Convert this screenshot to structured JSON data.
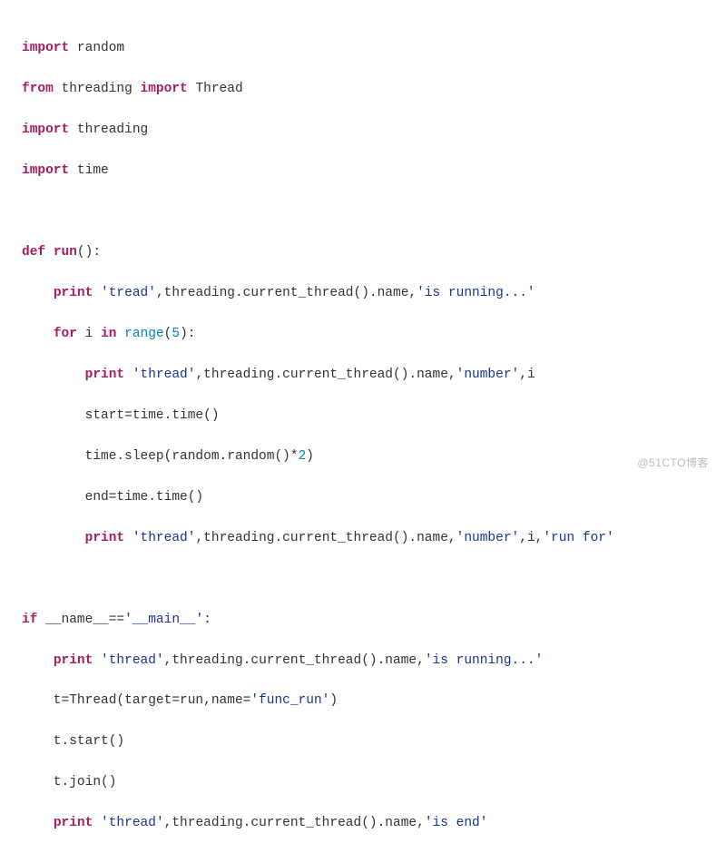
{
  "code": {
    "l1": {
      "a": "import",
      "b": " random"
    },
    "l2": {
      "a": "from",
      "b": " threading ",
      "c": "import",
      "d": " Thread"
    },
    "l3": {
      "a": "import",
      "b": " threading"
    },
    "l4": {
      "a": "import",
      "b": " time"
    },
    "l6": {
      "a": "def ",
      "b": "run",
      "c": "():"
    },
    "l7": {
      "a": "    ",
      "b": "print ",
      "c": "'tread'",
      "d": ",threading.current_thread().name,",
      "e": "'is running...'"
    },
    "l8": {
      "a": "    ",
      "b": "for",
      "c": " i ",
      "d": "in ",
      "e": "range",
      "f": "(",
      "g": "5",
      "h": "):"
    },
    "l9": {
      "a": "        ",
      "b": "print ",
      "c": "'thread'",
      "d": ",threading.current_thread().name,",
      "e": "'number'",
      "f": ",i"
    },
    "l10": {
      "a": "        start=time.time()"
    },
    "l11": {
      "a": "        time.sleep(random.random()*",
      "b": "2",
      "c": ")"
    },
    "l12": {
      "a": "        end=time.time()"
    },
    "l13": {
      "a": "        ",
      "b": "print ",
      "c": "'thread'",
      "d": ",threading.current_thread().name,",
      "e": "'number'",
      "f": ",i,",
      "g": "'run for'"
    },
    "l15": {
      "a": "if",
      "b": " __name__==",
      "c": "'__main__'",
      "d": ":"
    },
    "l16": {
      "a": "    ",
      "b": "print ",
      "c": "'thread'",
      "d": ",threading.current_thread().name,",
      "e": "'is running...'"
    },
    "l17": {
      "a": "    t=Thread(target=run,name=",
      "b": "'func_run'",
      "c": ")"
    },
    "l18": {
      "a": "    t.start()"
    },
    "l19": {
      "a": "    t.join()"
    },
    "l20": {
      "a": "    ",
      "b": "print ",
      "c": "'thread'",
      "d": ",threading.current_thread().name,",
      "e": "'is end'"
    }
  },
  "watermark": "@51CTO博客"
}
